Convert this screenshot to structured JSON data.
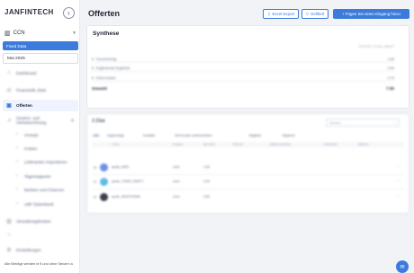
{
  "app": {
    "logo_text": "JANFINTECH",
    "company": "CCN",
    "fixed_label": "Fixed Data",
    "period": "Mai 2025"
  },
  "sidebar": {
    "items": [
      {
        "label": "Dashboard",
        "icon": "home-icon"
      },
      {
        "label": "Finanzielle Ziele",
        "icon": "target-icon"
      },
      {
        "label": "Offerten",
        "icon": "folder-icon",
        "active": true
      },
      {
        "label": "Gewinn- und Verlustrechnung",
        "icon": "chart-icon"
      }
    ],
    "sub_items": [
      {
        "label": "Umsatz"
      },
      {
        "label": "Kosten"
      },
      {
        "label": "Lieferanten Importieren"
      },
      {
        "label": "Tagesrapporte"
      },
      {
        "label": "Banken und Chancen"
      },
      {
        "label": "UBF Datenbank"
      }
    ],
    "bottom_items": [
      {
        "label": "Verwaltungskosten",
        "icon": "building-icon"
      },
      {
        "label": "",
        "icon": "circle-icon"
      },
      {
        "label": "Einstellungen",
        "icon": "gear-icon"
      }
    ],
    "footer": "Alle Beträge werden in € und ohne Steuern a"
  },
  "header": {
    "title": "Offerten",
    "export_label": "Excel Export",
    "filter_label": "Gefiltert",
    "add_label": "+ Fügen Sie einen Eingang hinzu"
  },
  "synthese": {
    "title": "Synthese",
    "column_header": "OFFERT-TOTAL-WERT",
    "rows": [
      {
        "label": "Grundvertrag",
        "value": "1.80"
      },
      {
        "label": "Ergänzende Angebote",
        "value": "3.00"
      },
      {
        "label": "Extra-Kosten",
        "value": "2.70"
      }
    ],
    "total_label": "Gesamt",
    "total_value": "7.50"
  },
  "table": {
    "title": "3 Zitat",
    "search_placeholder": "Suchen...",
    "filters": [
      "Alle",
      "Angebotstyp",
      "Kontakte",
      "Zeit Kunden unterschrieben",
      "Begleiter",
      "Begrenzt"
    ],
    "columns": [
      "TITEL",
      "KUNDE",
      "BETRAG",
      "STATUS",
      "ABRECHNUNG",
      "PROZENT",
      "WERTE"
    ],
    "rows": [
      {
        "title": "quote_6000",
        "client": "ccen",
        "amount": "1,00",
        "avatar_color": "#6f8ee8"
      },
      {
        "title": "quote_THIRD_PARTY",
        "client": "ccen",
        "amount": "4,00",
        "avatar_color": "#5fb9e6"
      },
      {
        "title": "quote_ADDITIONAL",
        "client": "ccen",
        "amount": "2,50",
        "avatar_color": "#3a3f4a"
      }
    ]
  },
  "colors": {
    "accent": "#3c7bdc",
    "background": "#f1f3f6"
  }
}
